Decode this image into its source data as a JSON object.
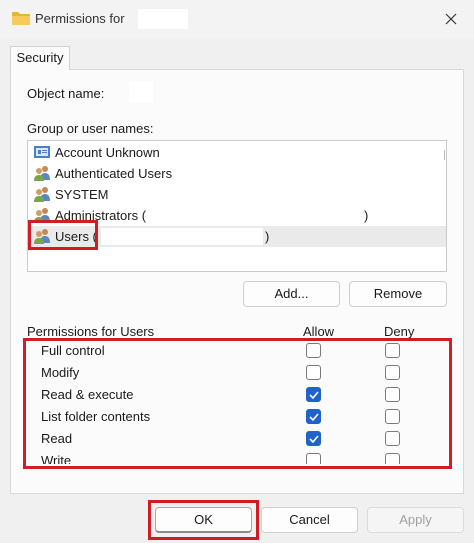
{
  "window": {
    "title": "Permissions for",
    "close_icon": "close-icon",
    "folder_icon": "folder-icon",
    "accent_color": "#d11b25"
  },
  "tabs": [
    {
      "label": "Security"
    }
  ],
  "object": {
    "label": "Object name:"
  },
  "group": {
    "label": "Group or user names:",
    "users": [
      {
        "name": "Account Unknown",
        "icon": "account-unknown-icon"
      },
      {
        "name": "Authenticated Users",
        "icon": "users-group-icon"
      },
      {
        "name": "SYSTEM",
        "icon": "users-group-icon"
      },
      {
        "name": "Administrators (",
        "suffix": ")",
        "icon": "users-group-icon"
      },
      {
        "name": "Users (",
        "suffix": ")",
        "icon": "users-group-icon",
        "selected": true
      }
    ]
  },
  "buttons": {
    "add": "Add...",
    "remove": "Remove",
    "ok": "OK",
    "cancel": "Cancel",
    "apply": "Apply"
  },
  "permissions": {
    "label": "Permissions for Users",
    "allow_label": "Allow",
    "deny_label": "Deny",
    "rows": [
      {
        "name": "Full control",
        "allow": false,
        "deny": false
      },
      {
        "name": "Modify",
        "allow": false,
        "deny": false
      },
      {
        "name": "Read & execute",
        "allow": true,
        "deny": false
      },
      {
        "name": "List folder contents",
        "allow": true,
        "deny": false
      },
      {
        "name": "Read",
        "allow": true,
        "deny": false
      },
      {
        "name": "Write",
        "allow": false,
        "deny": false
      }
    ]
  }
}
